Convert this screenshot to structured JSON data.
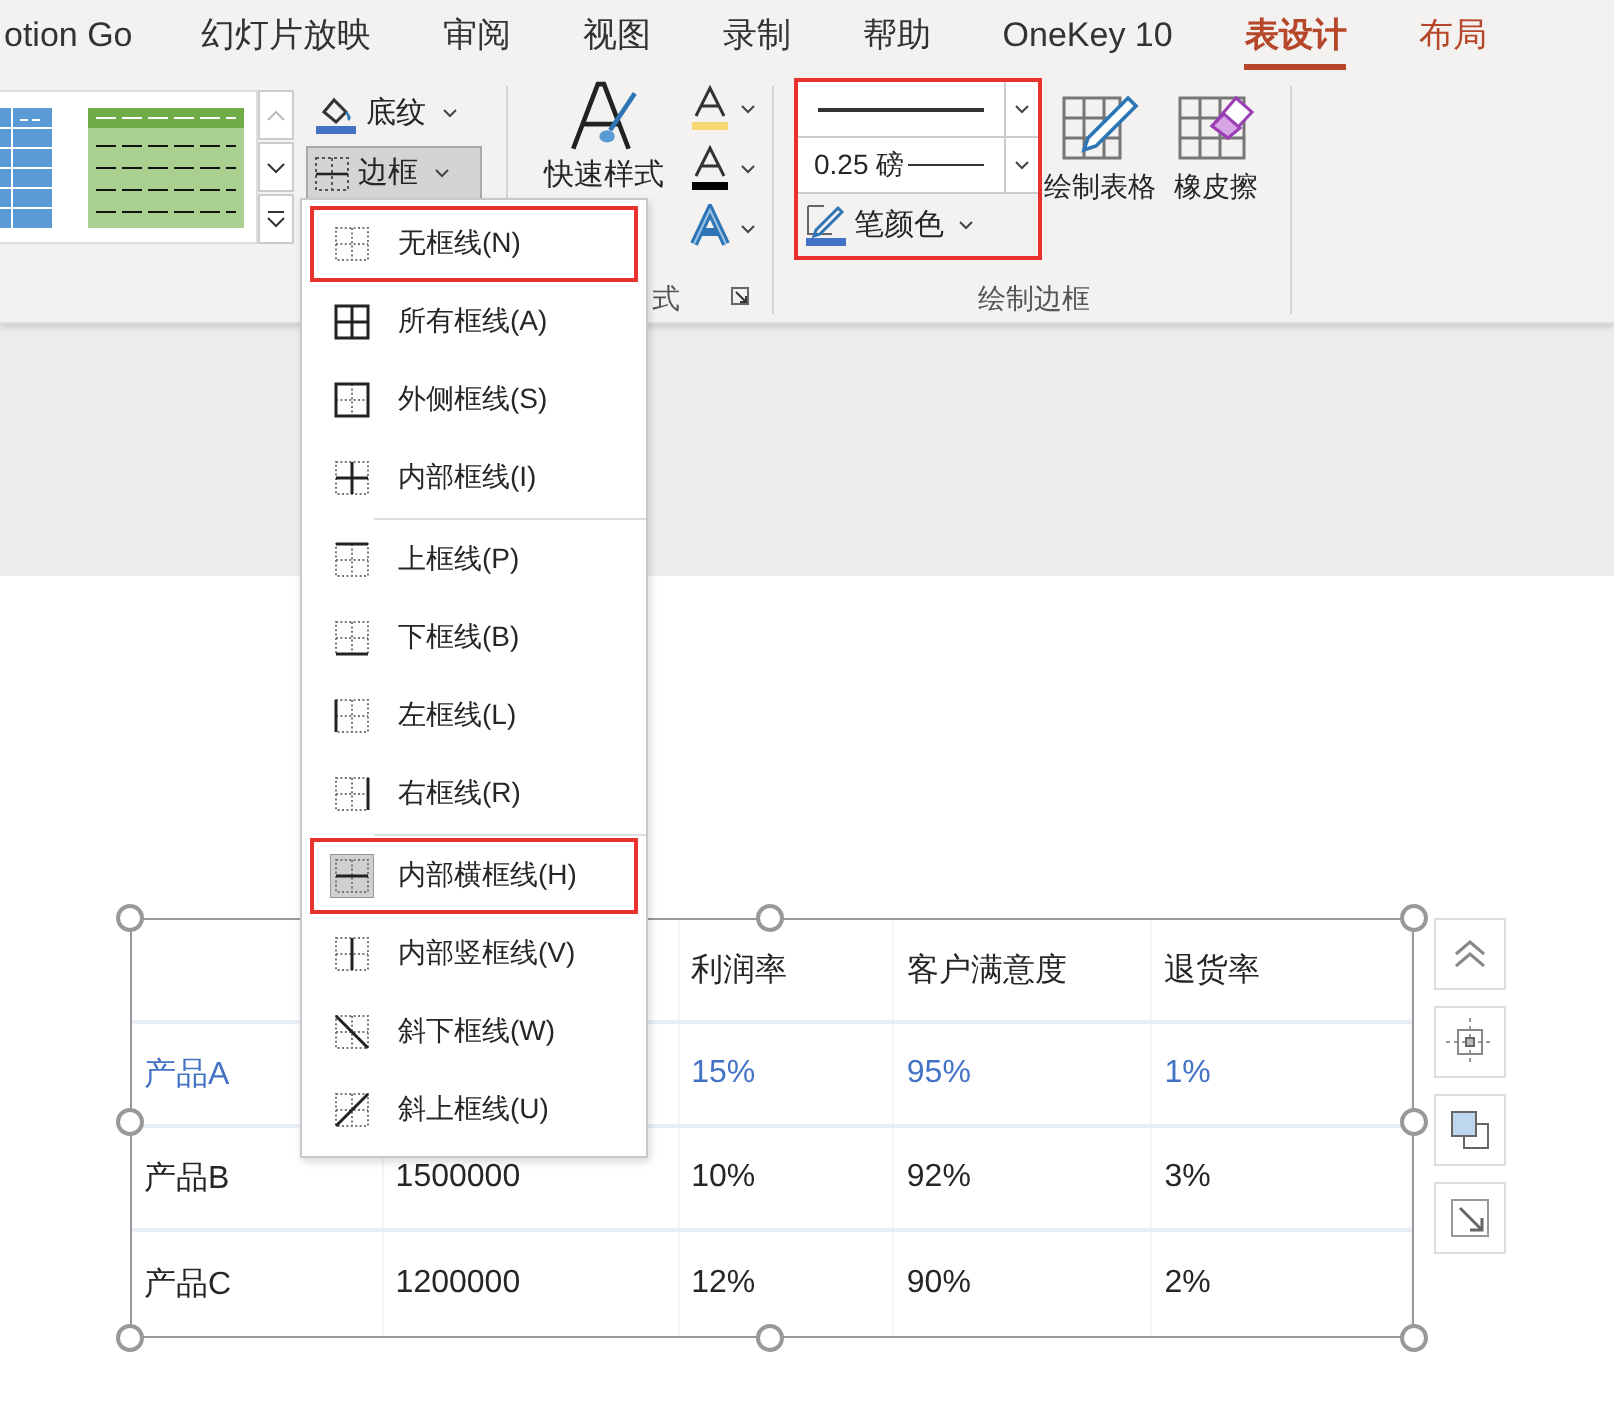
{
  "tabs": [
    {
      "label": "otion Go",
      "selected": false,
      "contextual": false
    },
    {
      "label": "幻灯片放映",
      "selected": false,
      "contextual": false
    },
    {
      "label": "审阅",
      "selected": false,
      "contextual": false
    },
    {
      "label": "视图",
      "selected": false,
      "contextual": false
    },
    {
      "label": "录制",
      "selected": false,
      "contextual": false
    },
    {
      "label": "帮助",
      "selected": false,
      "contextual": false
    },
    {
      "label": "OneKey 10",
      "selected": false,
      "contextual": false
    },
    {
      "label": "表设计",
      "selected": true,
      "contextual": true
    },
    {
      "label": "布局",
      "selected": false,
      "contextual": true
    }
  ],
  "ribbon": {
    "shading_button": "底纹",
    "border_button": {
      "label": "边框",
      "pressed": true
    },
    "quick_styles_label": "快速样式",
    "styles_group_label": "式",
    "pen_group": {
      "line_weight": "0.25 磅",
      "pen_color": "笔颜色",
      "annotated": true
    },
    "draw_table": "绘制表格",
    "eraser": "橡皮擦",
    "draw_borders_group_label": "绘制边框"
  },
  "border_menu": [
    {
      "label": "无框线(N)",
      "kind": "none",
      "selected": false,
      "annotated": true,
      "separator_after": false
    },
    {
      "label": "所有框线(A)",
      "kind": "all",
      "selected": false,
      "annotated": false,
      "separator_after": false
    },
    {
      "label": "外侧框线(S)",
      "kind": "outside",
      "selected": false,
      "annotated": false,
      "separator_after": false
    },
    {
      "label": "内部框线(I)",
      "kind": "inside",
      "selected": false,
      "annotated": false,
      "separator_after": true
    },
    {
      "label": "上框线(P)",
      "kind": "top",
      "selected": false,
      "annotated": false,
      "separator_after": false
    },
    {
      "label": "下框线(B)",
      "kind": "bottom",
      "selected": false,
      "annotated": false,
      "separator_after": false
    },
    {
      "label": "左框线(L)",
      "kind": "left",
      "selected": false,
      "annotated": false,
      "separator_after": false
    },
    {
      "label": "右框线(R)",
      "kind": "right",
      "selected": false,
      "annotated": false,
      "separator_after": true
    },
    {
      "label": "内部横框线(H)",
      "kind": "inside_h",
      "selected": true,
      "annotated": true,
      "separator_after": false
    },
    {
      "label": "内部竖框线(V)",
      "kind": "inside_v",
      "selected": false,
      "annotated": false,
      "separator_after": false
    },
    {
      "label": "斜下框线(W)",
      "kind": "diag_down",
      "selected": false,
      "annotated": false,
      "separator_after": false
    },
    {
      "label": "斜上框线(U)",
      "kind": "diag_up",
      "selected": false,
      "annotated": false,
      "separator_after": false
    }
  ],
  "table": {
    "rows": [
      {
        "highlighted": false,
        "cells": [
          null,
          null,
          "利润率",
          "客户满意度",
          "退货率"
        ]
      },
      {
        "highlighted": true,
        "cells": [
          "产品A",
          null,
          "15%",
          "95%",
          "1%"
        ]
      },
      {
        "highlighted": false,
        "cells": [
          "产品B",
          "1500000",
          "10%",
          "92%",
          "3%"
        ]
      },
      {
        "highlighted": false,
        "cells": [
          "产品C",
          "1200000",
          "12%",
          "90%",
          "2%"
        ]
      }
    ]
  }
}
